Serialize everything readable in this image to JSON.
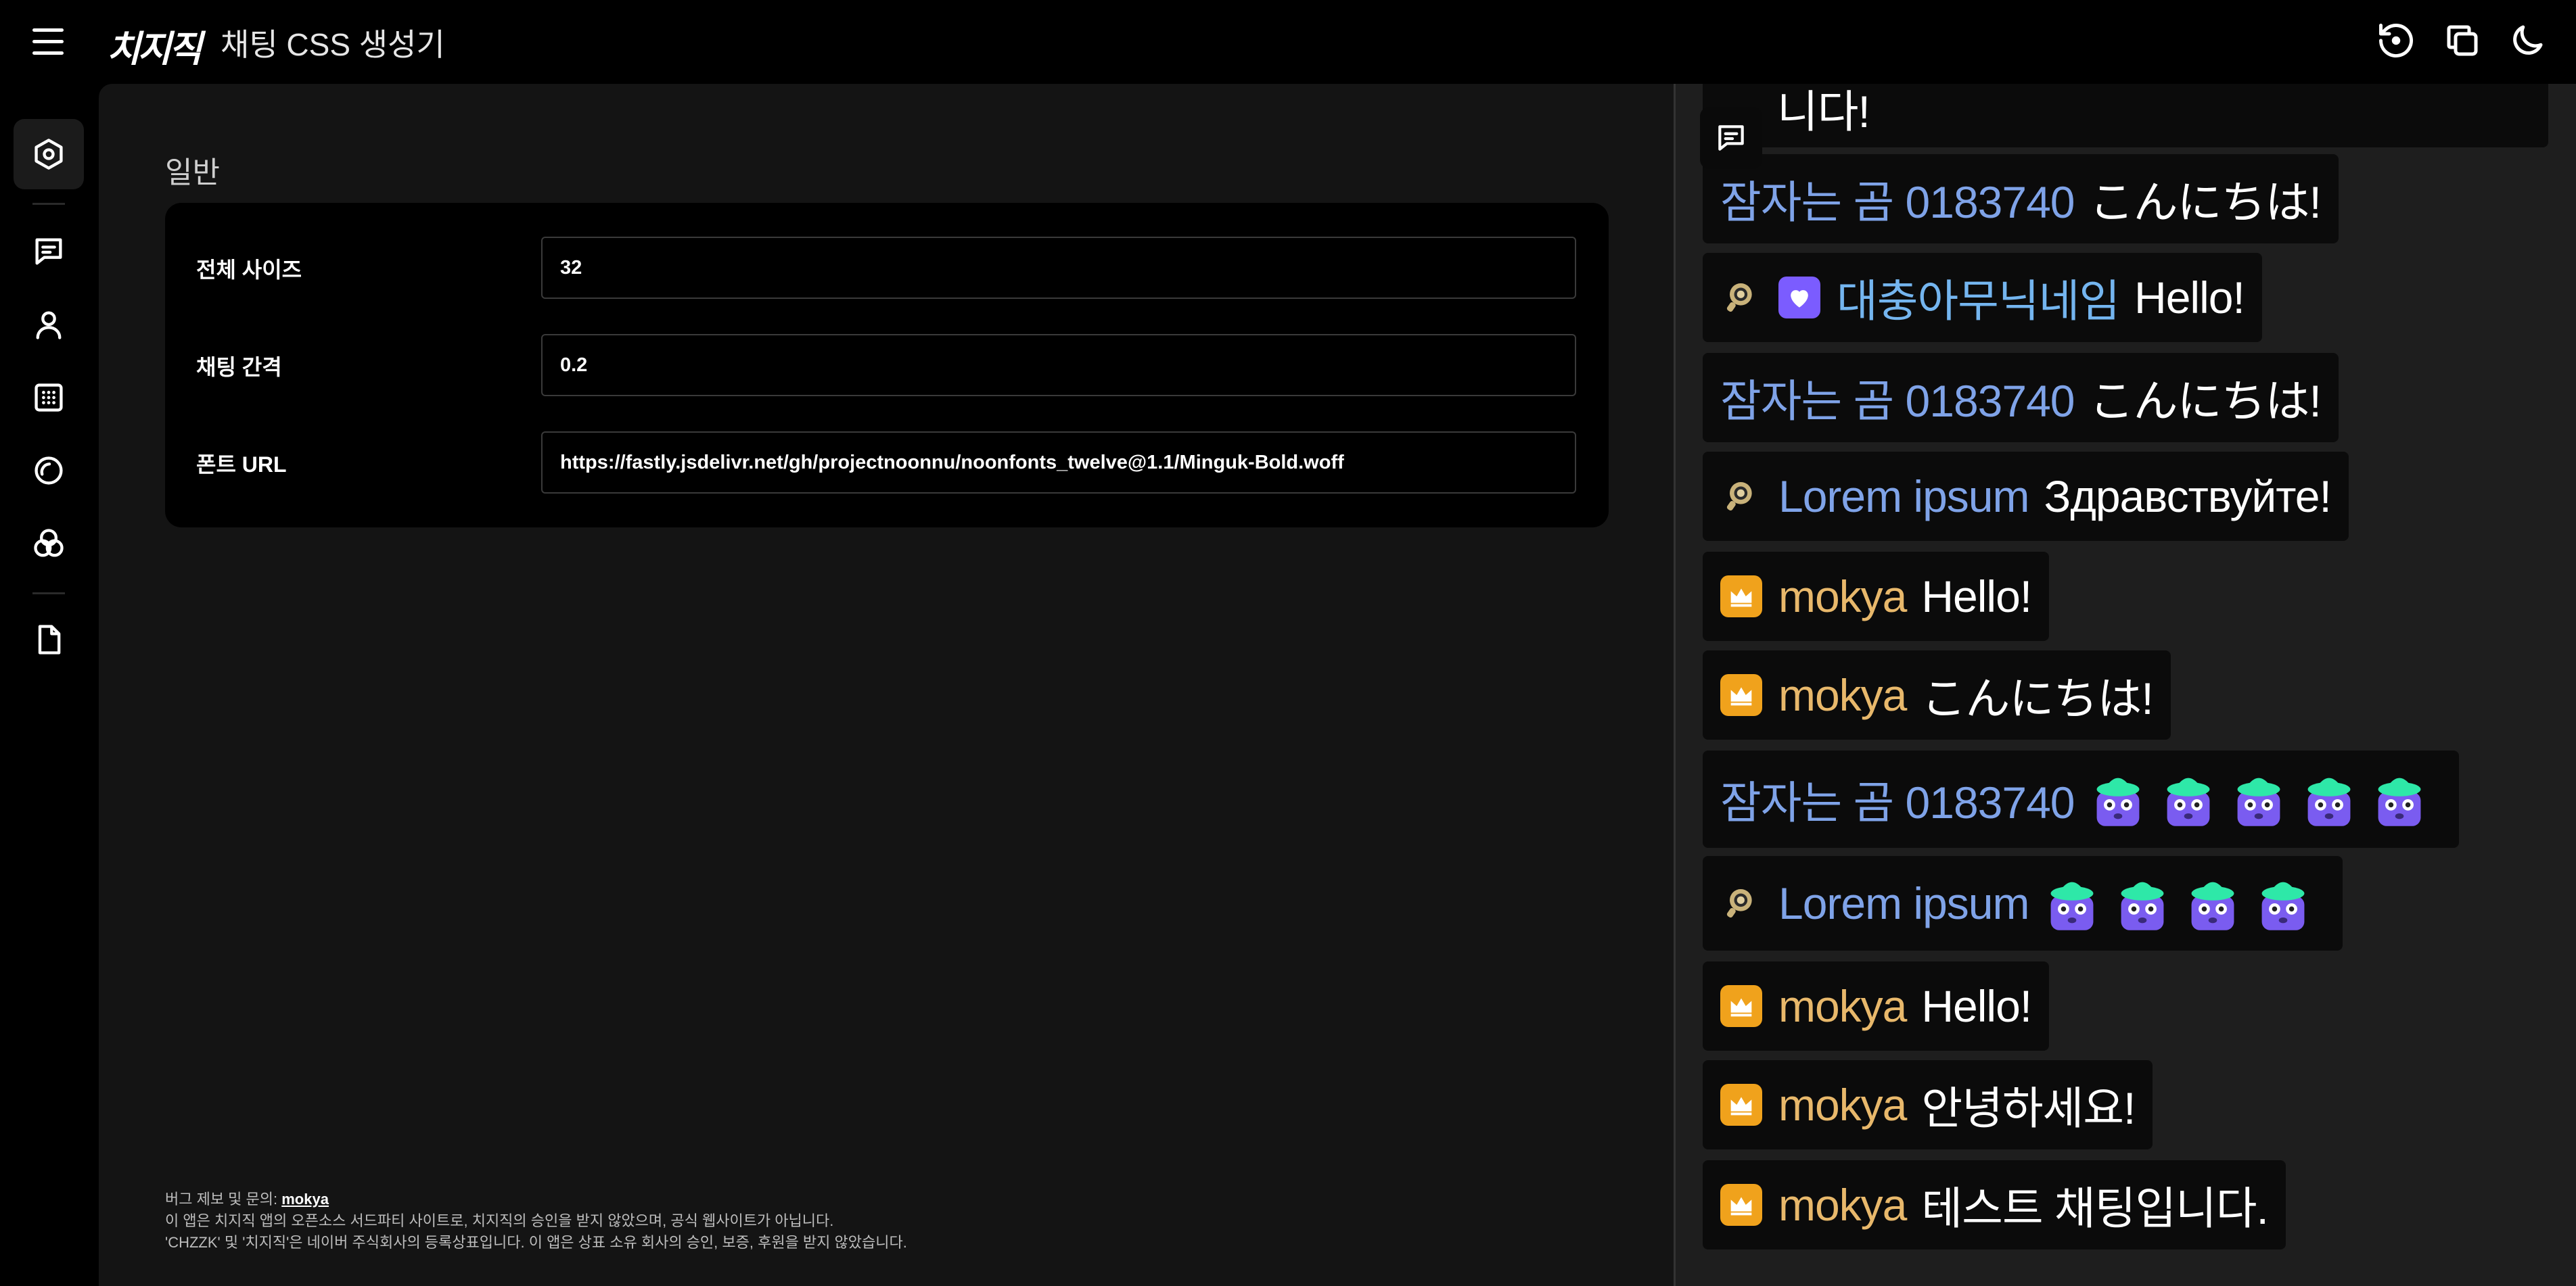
{
  "app": {
    "logo": "치지직",
    "title": "채팅 CSS 생성기"
  },
  "topbar_icons": [
    "menu-icon",
    "history-icon",
    "copy-icon",
    "moon-icon"
  ],
  "sidebar": {
    "items": [
      "settings-icon",
      "chat-icon",
      "user-icon",
      "badge-icon",
      "circle-icon",
      "palette-icon",
      "file-icon"
    ],
    "active_index": 0
  },
  "main": {
    "section_title": "일반",
    "rows": [
      {
        "label": "전체 사이즈",
        "value": "32"
      },
      {
        "label": "채팅 간격",
        "value": "0.2"
      },
      {
        "label": "폰트 URL",
        "value": "https://fastly.jsdelivr.net/gh/projectnoonnu/noonfonts_twelve@1.1/Minguk-Bold.woff"
      }
    ],
    "footer": {
      "report_prefix": "버그 제보 및 문의: ",
      "report_link": "mokya",
      "line2": "이 앱은 치지직 앱의 오픈소스 서드파티 사이트로, 치지직의 승인을 받지 않았으며, 공식 웹사이트가 아닙니다.",
      "line3": "'CHZZK' 및 '치지직'은 네이버 주식회사의 등록상표입니다. 이 앱은 상표 소유 회사의 승인, 보증, 후원을 받지 않았습니다."
    }
  },
  "preview": {
    "partial_text": "니다!",
    "messages": [
      {
        "nick": "잠자는 곰 0183740",
        "text": "こんにちは!",
        "badges": []
      },
      {
        "nick": "대충아무닉네임",
        "text": "Hello!",
        "badges": [
          "coin",
          "heart"
        ]
      },
      {
        "nick": "잠자는 곰 0183740",
        "text": "こんにちは!",
        "badges": []
      },
      {
        "nick": "Lorem ipsum",
        "text": "Здравствуйте!",
        "badges": [
          "coin"
        ]
      },
      {
        "nick": "mokya",
        "text": "Hello!",
        "badges": [
          "crown"
        ]
      },
      {
        "nick": "mokya",
        "text": "こんにちは!",
        "badges": [
          "crown"
        ]
      },
      {
        "nick": "잠자는 곰 0183740",
        "text": "",
        "badges": [],
        "emotes": 5
      },
      {
        "nick": "Lorem ipsum",
        "text": "",
        "badges": [
          "coin"
        ],
        "emotes": 4
      },
      {
        "nick": "mokya",
        "text": "Hello!",
        "badges": [
          "crown"
        ]
      },
      {
        "nick": "mokya",
        "text": "안녕하세요!",
        "badges": [
          "crown"
        ]
      },
      {
        "nick": "mokya",
        "text": "테스트 채팅입니다.",
        "badges": [
          "crown"
        ]
      }
    ]
  },
  "colors": {
    "nick_blue": "#7fa3e8",
    "nick_sky": "#74b5ef",
    "nick_gold": "#e8b86b",
    "crown_badge": "#f0a21c",
    "heart_badge": "#7b5cff",
    "emote_body": "#7a5cf0",
    "emote_hat": "#2ee8a8"
  }
}
